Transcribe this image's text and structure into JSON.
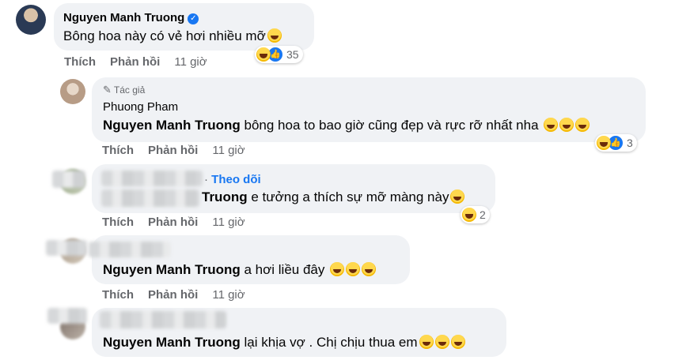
{
  "comments": [
    {
      "author": "Nguyen Manh Truong",
      "verified": true,
      "text": "Bông hoa này có vẻ hơi nhiều mỡ",
      "actions": {
        "like": "Thích",
        "reply": "Phản hồi",
        "time": "11 giờ"
      },
      "reactions": {
        "icons": [
          "haha-icon",
          "like-icon"
        ],
        "count": "35"
      }
    },
    {
      "badge": "Tác giả",
      "author": "Phuong Pham",
      "mention": "Nguyen Manh Truong",
      "text": " bông hoa to bao giờ cũng đẹp và rực rỡ nhất nha",
      "actions": {
        "like": "Thích",
        "reply": "Phản hồi",
        "time": "11 giờ"
      },
      "reactions": {
        "icons": [
          "haha-icon",
          "like-icon"
        ],
        "count": "3"
      }
    },
    {
      "follow": "Theo dõi",
      "mention": "Truong",
      "text": " e tưởng a thích sự mỡ màng này",
      "actions": {
        "like": "Thích",
        "reply": "Phản hồi",
        "time": "11 giờ"
      },
      "reactions": {
        "icons": [
          "haha-icon"
        ],
        "count": "2"
      }
    },
    {
      "mention": "Nguyen Manh Truong",
      "text": " a hơi liều đây",
      "actions": {
        "like": "Thích",
        "reply": "Phản hồi",
        "time": "11 giờ"
      }
    },
    {
      "mention": "Nguyen Manh Truong",
      "text": " lại khịa vợ . Chị chịu thua em"
    }
  ],
  "colors": {
    "link": "#1877f2",
    "bubble": "#f0f2f5",
    "muted": "#65676b"
  }
}
